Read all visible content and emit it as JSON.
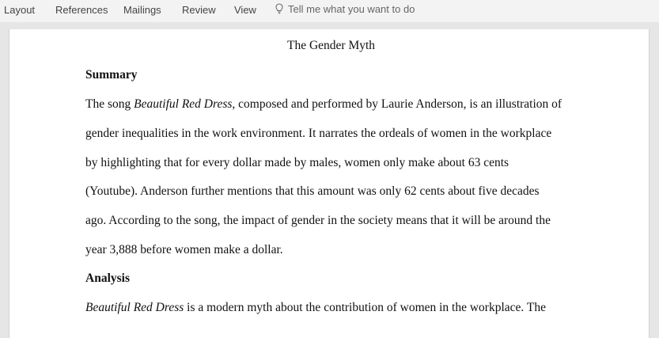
{
  "ribbon": {
    "tabs": [
      "Layout",
      "References",
      "Mailings",
      "Review",
      "View"
    ],
    "tell_me": "Tell me what you want to do",
    "tell_me_icon": "lightbulb-icon"
  },
  "document": {
    "title": "The Gender Myth",
    "summary_heading": "Summary",
    "summary_lines": [
      {
        "pre": "The song ",
        "em": "Beautiful Red Dress",
        "post": ", composed and performed by Laurie Anderson, is an illustration of"
      },
      {
        "pre": "gender inequalities in the work environment. It narrates the ordeals of women in the workplace",
        "em": "",
        "post": ""
      },
      {
        "pre": "by highlighting that for every dollar made by males, women only make about 63 cents",
        "em": "",
        "post": ""
      },
      {
        "pre": "(Youtube). Anderson further mentions that this amount was only 62 cents about five decades",
        "em": "",
        "post": ""
      },
      {
        "pre": "ago. According to the song, the impact of gender in the society means that it will be around the",
        "em": "",
        "post": ""
      },
      {
        "pre": "year 3,888 before women make a dollar.",
        "em": "",
        "post": ""
      }
    ],
    "analysis_heading": "Analysis",
    "analysis_lines": [
      {
        "pre": "",
        "em": "Beautiful Red Dress",
        "post": " is a modern myth about the contribution of women in the workplace. The"
      }
    ]
  }
}
